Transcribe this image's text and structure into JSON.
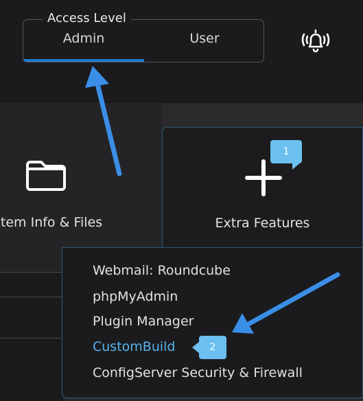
{
  "access": {
    "legend": "Access Level",
    "options": [
      "Admin",
      "User"
    ],
    "selected": "Admin"
  },
  "header": {
    "bell_icon": "bell-ringing-icon"
  },
  "cards": {
    "system": {
      "label": "stem Info & Files",
      "icon": "folder-icon"
    },
    "extra": {
      "label": "Extra Features",
      "icon": "plus-icon"
    }
  },
  "menu": {
    "items": [
      "Webmail: Roundcube",
      "phpMyAdmin",
      "Plugin Manager",
      "CustomBuild",
      "ConfigServer Security & Firewall"
    ],
    "active": "CustomBuild"
  },
  "annotations": {
    "badge1": "1",
    "badge2": "2",
    "accent_color": "#6bc0ef",
    "arrow_color": "#3a8ee6"
  }
}
